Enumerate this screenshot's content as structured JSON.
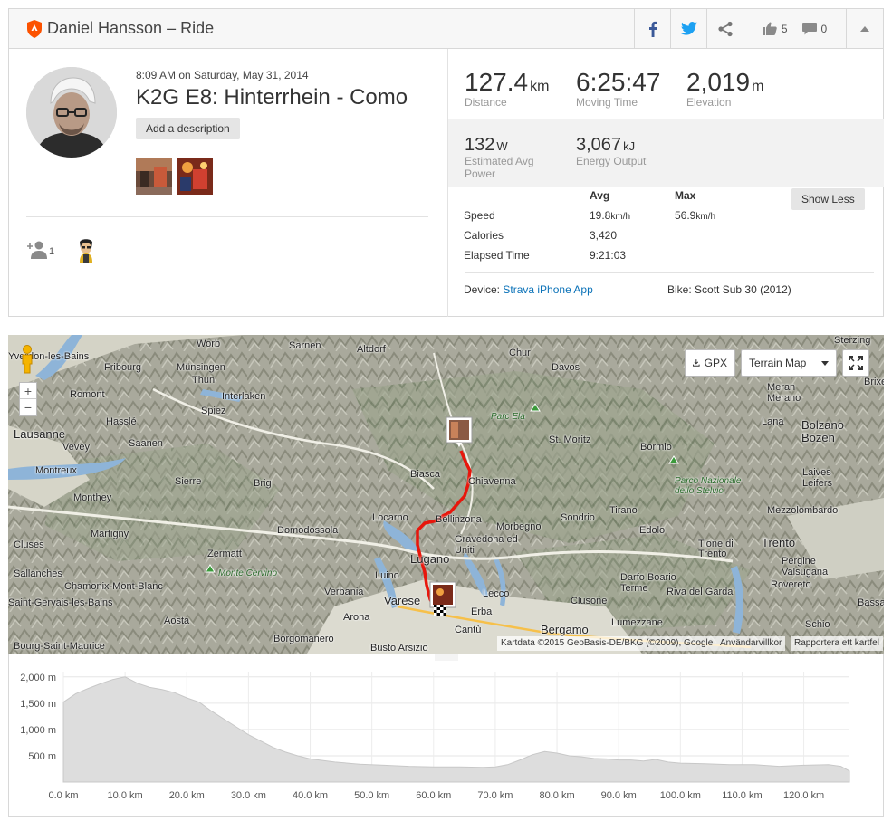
{
  "header": {
    "title": "Daniel Hansson – Ride",
    "kudos_count": "5",
    "comment_count": "0"
  },
  "activity": {
    "date": "8:09 AM on Saturday, May 31, 2014",
    "title": "K2G E8: Hinterrhein - Como",
    "add_description": "Add a description",
    "kudos": "1"
  },
  "stats": {
    "distance": {
      "value": "127.4",
      "unit": "km",
      "label": "Distance"
    },
    "moving_time": {
      "value": "6:25:47",
      "label": "Moving Time"
    },
    "elevation": {
      "value": "2,019",
      "unit": "m",
      "label": "Elevation"
    },
    "power": {
      "value": "132",
      "unit": "W",
      "label1": "Estimated Avg",
      "label2": "Power"
    },
    "energy": {
      "value": "3,067",
      "unit": "kJ",
      "label": "Energy Output"
    }
  },
  "details": {
    "avg_header": "Avg",
    "max_header": "Max",
    "show_less": "Show Less",
    "rows": [
      {
        "label": "Speed",
        "avg": "19.8",
        "avg_unit": "km/h",
        "max": "56.9",
        "max_unit": "km/h"
      },
      {
        "label": "Calories",
        "avg": "3,420",
        "max": ""
      },
      {
        "label": "Elapsed Time",
        "avg": "9:21:03",
        "max": ""
      }
    ],
    "device_label": "Device:",
    "device_value": "Strava iPhone App",
    "bike_label": "Bike:",
    "bike_value": "Scott Sub 30 (2012)"
  },
  "map": {
    "gpx": "GPX",
    "map_type": "Terrain Map",
    "zoom_in": "+",
    "zoom_out": "−",
    "attribution": "Kartdata ©2015 GeoBasis-DE/BKG (©2009), Google",
    "terms": "Användarvillkor",
    "report": "Rapportera ett kartfel",
    "labels": [
      "Worb",
      "Sarnen",
      "Altdorf",
      "Chur",
      "Davos",
      "Sterzing",
      "Fribourg",
      "Münsingen",
      "Thun",
      "Interlaken",
      "Romont",
      "Spiez",
      "Meran",
      "Merano",
      "Brixen",
      "Parc Ela",
      "St. Moritz",
      "Lana",
      "Bolzano",
      "Bozen",
      "Lausanne",
      "Vevey",
      "Hasslé",
      "Saanen",
      "Bormio",
      "Biasca",
      "Chiavenna",
      "Laives",
      "Leifers",
      "Montreux",
      "Sierre",
      "Brig",
      "Parco Nazionale dello Stelvio",
      "Monthey",
      "Locarno",
      "Bellinzona",
      "Morbegno",
      "Sondrio",
      "Tirano",
      "Mezzolombardo",
      "Martigny",
      "Domodossola",
      "Gravedona ed Uniti",
      "Edolo",
      "Cluses",
      "Zermatt",
      "Lugano",
      "Trento",
      "Sallanches",
      "Monte Cervino",
      "Luino",
      "Darfo Boario Terme",
      "Pergine Valsugana",
      "Chamonix-Mont-Blanc",
      "Verbania",
      "Lecco",
      "Clusone",
      "Riva del Garda",
      "Rovereto",
      "Varese",
      "Erba",
      "Aosta",
      "Arona",
      "Cantù",
      "Bergamo",
      "Schio",
      "Borgomanero",
      "Bourg-Saint-Maurice",
      "Busto Arsizio",
      "Lumezzane",
      "Bassano",
      "Saint-Gervais-les-Bains",
      "Yverdon-les-Bains",
      "Tione di Trento"
    ]
  },
  "elevation_chart": {
    "chart_data": {
      "type": "area",
      "x": [
        0,
        2,
        4,
        6,
        8,
        10,
        12,
        14,
        16,
        18,
        20,
        22,
        24,
        26,
        28,
        30,
        32,
        34,
        36,
        38,
        40,
        44,
        48,
        52,
        56,
        60,
        64,
        68,
        70,
        72,
        74,
        76,
        78,
        80,
        82,
        84,
        86,
        88,
        90,
        92,
        94,
        96,
        98,
        100,
        104,
        108,
        112,
        116,
        120,
        124,
        126,
        127.4
      ],
      "y": [
        1520,
        1680,
        1780,
        1870,
        1950,
        2000,
        1880,
        1800,
        1760,
        1700,
        1600,
        1520,
        1350,
        1200,
        1050,
        900,
        780,
        660,
        570,
        500,
        440,
        380,
        340,
        320,
        300,
        290,
        290,
        280,
        290,
        330,
        420,
        520,
        580,
        550,
        500,
        480,
        450,
        440,
        420,
        420,
        400,
        430,
        380,
        360,
        350,
        330,
        330,
        300,
        320,
        330,
        300,
        210
      ],
      "xlabel": "",
      "ylabel": "",
      "xlim": [
        0,
        127.4
      ],
      "ylim": [
        0,
        2100
      ],
      "x_ticks": [
        "0.0 km",
        "10.0 km",
        "20.0 km",
        "30.0 km",
        "40.0 km",
        "50.0 km",
        "60.0 km",
        "70.0 km",
        "80.0 km",
        "90.0 km",
        "100.0 km",
        "110.0 km",
        "120.0 km"
      ],
      "y_ticks": [
        "500 m",
        "1,000 m",
        "1,500 m",
        "2,000 m"
      ],
      "grid": true,
      "fill_color": "#dddddd"
    }
  }
}
